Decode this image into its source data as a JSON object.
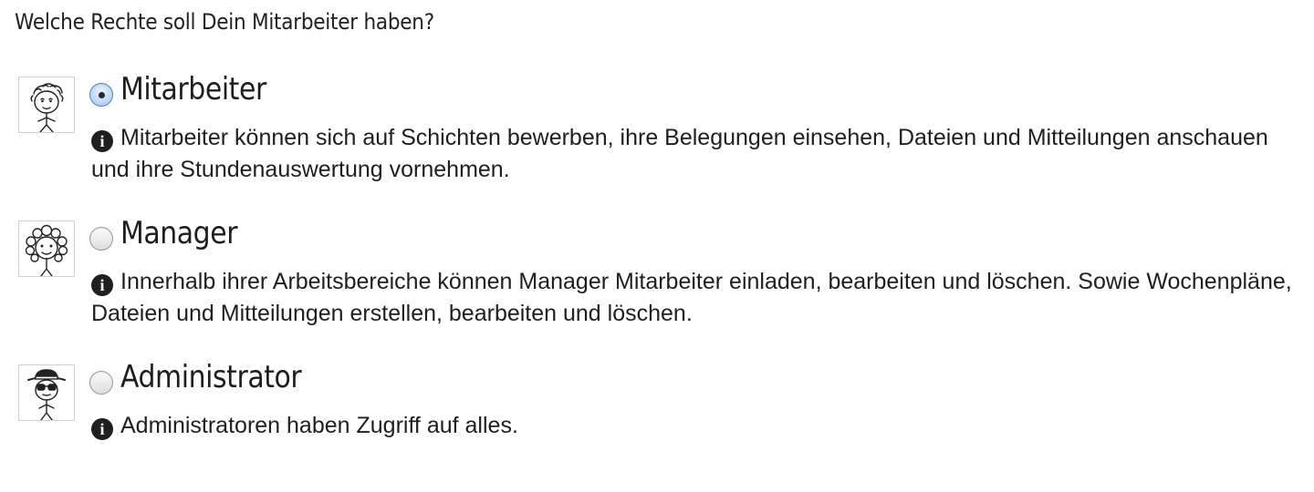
{
  "question": "Welche Rechte soll Dein Mitarbeiter haben?",
  "roles": [
    {
      "name": "Mitarbeiter",
      "selected": true,
      "icon": "employee-avatar-icon",
      "description": "Mitarbeiter können sich auf Schichten bewerben, ihre Belegungen einsehen, Dateien und Mitteilungen anschauen und ihre Stundenauswertung vornehmen."
    },
    {
      "name": "Manager",
      "selected": false,
      "icon": "manager-avatar-icon",
      "description": "Innerhalb ihrer Arbeitsbereiche können Manager Mitarbeiter einladen, bearbeiten und löschen. Sowie Wochenpläne, Dateien und Mitteilungen erstellen, bearbeiten und löschen."
    },
    {
      "name": "Administrator",
      "selected": false,
      "icon": "administrator-avatar-icon",
      "description": "Administratoren haben Zugriff auf alles."
    }
  ],
  "info_icon_glyph": "i"
}
